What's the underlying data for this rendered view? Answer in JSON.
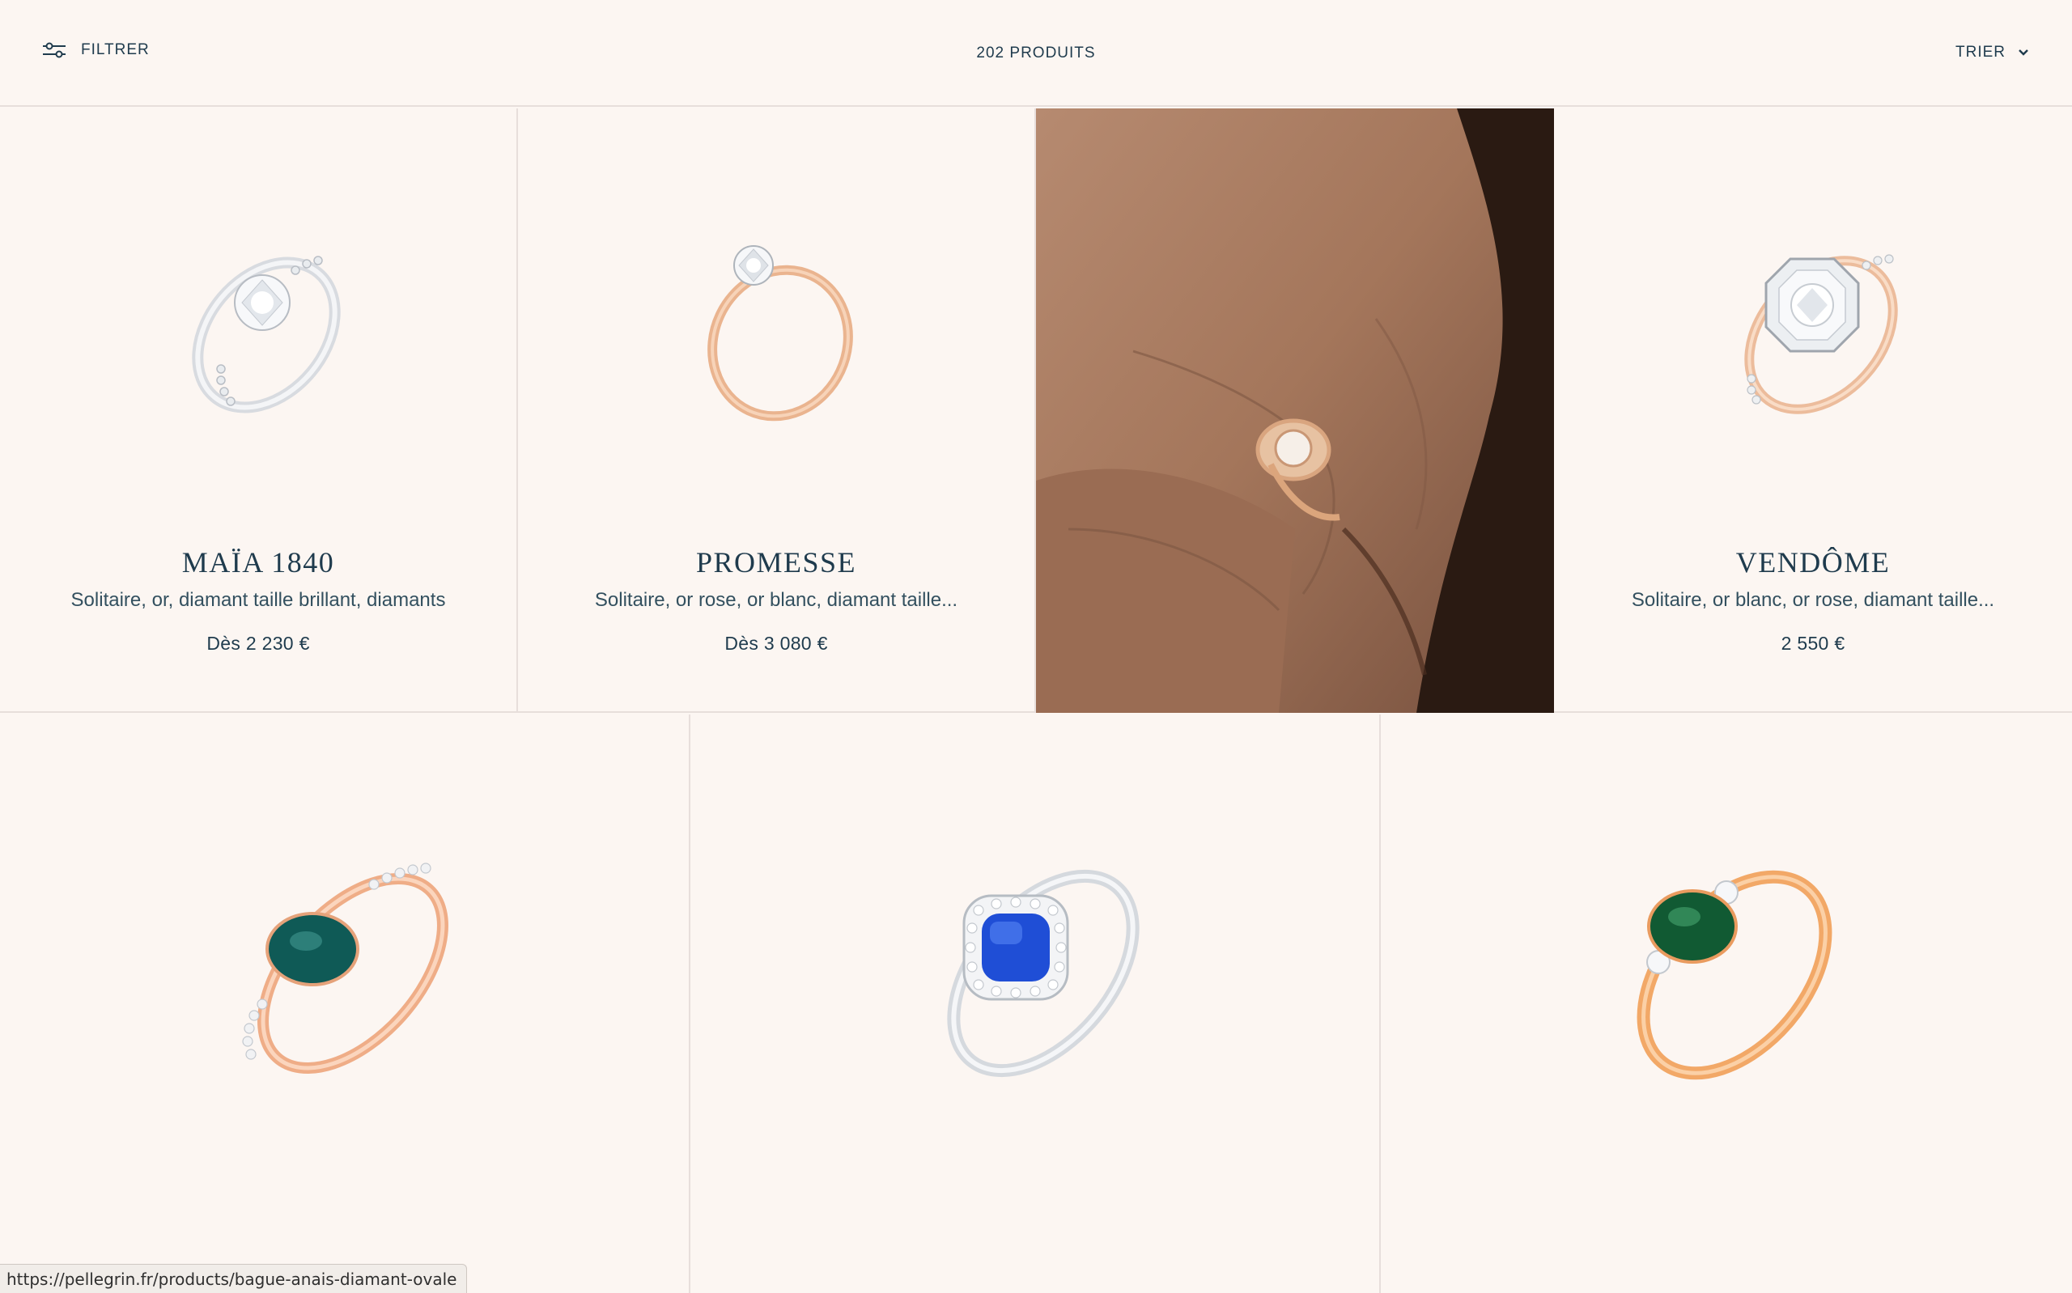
{
  "toolbar": {
    "filter_label": "FILTRER",
    "filter_icon": "sliders-icon",
    "product_count": "202 PRODUITS",
    "sort_label": "TRIER",
    "sort_icon": "chevron-down-icon"
  },
  "products_row1": [
    {
      "name": "MAÏA 1840",
      "desc": "Solitaire, or, diamant taille brillant, diamants",
      "price": "Dès 2 230 €",
      "metal": "white"
    },
    {
      "name": "PROMESSE",
      "desc": "Solitaire, or rose, or blanc, diamant taille...",
      "price": "Dès 3 080 €",
      "metal": "rose"
    },
    {
      "name": "VENDÔME",
      "desc": "Solitaire, or blanc, or rose, diamant taille...",
      "price": "2 550 €",
      "metal": "rose"
    }
  ],
  "products_row2": [
    {
      "stone": "teal-sapphire",
      "metal": "rose"
    },
    {
      "stone": "blue-sapphire-halo",
      "metal": "white"
    },
    {
      "stone": "green-emerald",
      "metal": "yellow-rose"
    }
  ],
  "colors": {
    "background": "#fcf6f2",
    "text": "#1f3b4d",
    "border": "#e7dedb"
  },
  "status_bar": {
    "url": "https://pellegrin.fr/products/bague-anais-diamant-ovale"
  }
}
